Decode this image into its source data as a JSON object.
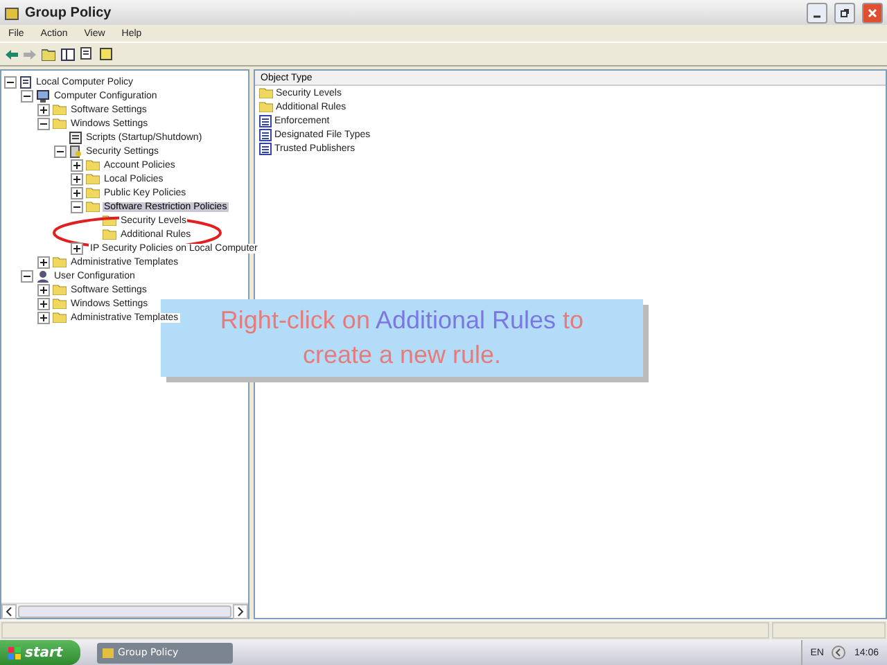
{
  "window": {
    "title": "Group Policy"
  },
  "menu": [
    "File",
    "Action",
    "View",
    "Help"
  ],
  "tree": [
    {
      "label": "Local Computer Policy",
      "kind": "policy",
      "selected": false,
      "expanded": true,
      "children": [
        {
          "label": "Computer Configuration",
          "kind": "computer",
          "selected": false,
          "expanded": true,
          "children": [
            {
              "label": "Software Settings",
              "kind": "folder",
              "selected": false,
              "expanded": false
            },
            {
              "label": "Windows Settings",
              "kind": "folder",
              "selected": false,
              "expanded": true,
              "children": [
                {
                  "label": "Scripts (Startup/Shutdown)",
                  "kind": "scripts",
                  "selected": false
                },
                {
                  "label": "Security Settings",
                  "kind": "security",
                  "selected": false,
                  "expanded": true,
                  "children": [
                    {
                      "label": "Account Policies",
                      "kind": "folder",
                      "selected": false,
                      "expanded": false
                    },
                    {
                      "label": "Local Policies",
                      "kind": "folder",
                      "selected": false,
                      "expanded": false
                    },
                    {
                      "label": "Public Key Policies",
                      "kind": "folder",
                      "selected": false,
                      "expanded": false
                    },
                    {
                      "label": "Software Restriction Policies",
                      "kind": "folder",
                      "selected": true,
                      "expanded": true,
                      "children": [
                        {
                          "label": "Security Levels",
                          "kind": "folder",
                          "selected": false
                        },
                        {
                          "label": "Additional Rules",
                          "kind": "folder",
                          "selected": false
                        }
                      ]
                    },
                    {
                      "label": "IP Security Policies on Local Computer",
                      "kind": "security",
                      "selected": false,
                      "expanded": false
                    }
                  ]
                }
              ]
            },
            {
              "label": "Administrative Templates",
              "kind": "folder",
              "selected": false,
              "expanded": false
            }
          ]
        },
        {
          "label": "User Configuration",
          "kind": "user",
          "selected": false,
          "expanded": true,
          "children": [
            {
              "label": "Software Settings",
              "kind": "folder",
              "selected": false,
              "expanded": false
            },
            {
              "label": "Windows Settings",
              "kind": "folder",
              "selected": false,
              "expanded": false
            },
            {
              "label": "Administrative Templates",
              "kind": "folder",
              "selected": false,
              "expanded": false
            }
          ]
        }
      ]
    }
  ],
  "list": {
    "column": "Object Type",
    "items": [
      {
        "label": "Security Levels",
        "kind": "folder"
      },
      {
        "label": "Additional Rules",
        "kind": "folder"
      },
      {
        "label": "Enforcement",
        "kind": "setting"
      },
      {
        "label": "Designated File Types",
        "kind": "setting"
      },
      {
        "label": "Trusted Publishers",
        "kind": "setting"
      }
    ]
  },
  "callout": {
    "parts": [
      {
        "text": "Right-click on ",
        "highlight": false
      },
      {
        "text": "Additional Rules",
        "highlight": true
      },
      {
        "text": " to create a new rule.",
        "highlight": false
      }
    ]
  },
  "taskbar": {
    "start": "start",
    "tasks": [
      {
        "label": "Group Policy",
        "selected": false
      }
    ],
    "language": "EN",
    "clock": "14:06"
  }
}
